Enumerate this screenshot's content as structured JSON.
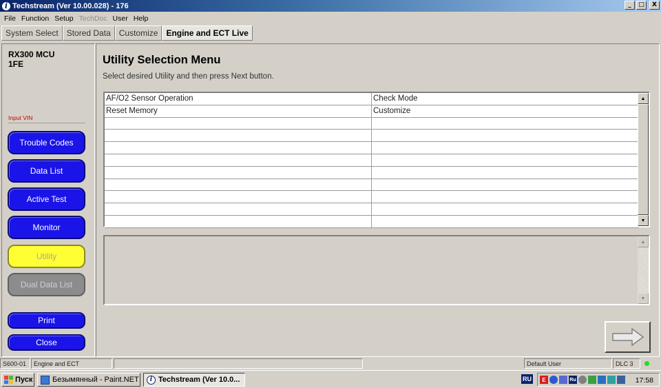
{
  "window": {
    "title": "Techstream (Ver 10.00.028) - 176",
    "app_icon": "i",
    "controls": [
      "_",
      "□",
      "X"
    ]
  },
  "menu": [
    "File",
    "Function",
    "Setup",
    "TechDoc",
    "User",
    "Help"
  ],
  "menu_disabled": [
    "TechDoc"
  ],
  "tabs": [
    {
      "label": "System Select",
      "active": false
    },
    {
      "label": "Stored Data",
      "active": false
    },
    {
      "label": "Customize",
      "active": false
    },
    {
      "label": "Engine and ECT Live",
      "active": true
    }
  ],
  "vehicle": {
    "line1": "RX300 MCU",
    "line2": "1FE"
  },
  "input_vin": "Input VIN",
  "nav": {
    "trouble_codes": "Trouble Codes",
    "data_list": "Data List",
    "active_test": "Active Test",
    "monitor": "Monitor",
    "utility": "Utility",
    "dual_data_list": "Dual Data List",
    "print": "Print",
    "close": "Close"
  },
  "main": {
    "title": "Utility Selection Menu",
    "subtitle": "Select desired Utility and then press Next button.",
    "rows": [
      [
        "AF/O2 Sensor Operation",
        "Check Mode"
      ],
      [
        "Reset Memory",
        "Customize"
      ],
      [
        "",
        ""
      ],
      [
        "",
        ""
      ],
      [
        "",
        ""
      ],
      [
        "",
        ""
      ],
      [
        "",
        ""
      ],
      [
        "",
        ""
      ],
      [
        "",
        ""
      ],
      [
        "",
        ""
      ],
      [
        "",
        ""
      ]
    ]
  },
  "statusbar": {
    "code": "S600-01",
    "system": "Engine and ECT",
    "user": "Default User",
    "dlc": "DLC 3"
  },
  "taskbar": {
    "start": "Пуск",
    "tasks": [
      "Безымянный - Paint.NET ...",
      "Techstream (Ver 10.0..."
    ],
    "lang": "RU",
    "clock": "17:58"
  },
  "colors": {
    "nav_blue": "#1a14e8",
    "utility_yellow": "#ffff33",
    "disabled_gray": "#8c8c8c",
    "led_green": "#22dd22",
    "vin_red": "#cc0000"
  }
}
